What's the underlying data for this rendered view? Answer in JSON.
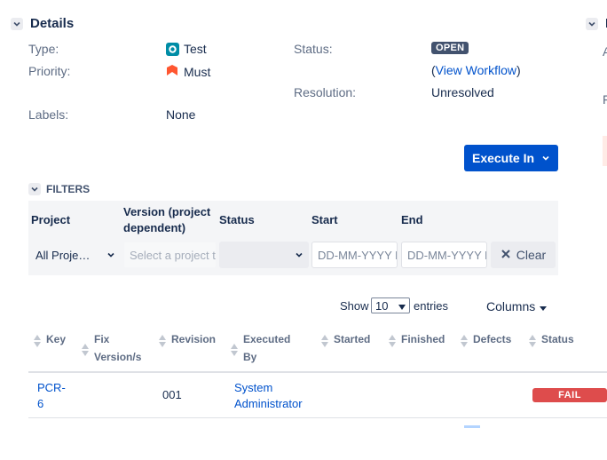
{
  "details": {
    "heading": "Details",
    "type_label": "Type:",
    "type_value": "Test",
    "priority_label": "Priority:",
    "priority_value": "Must",
    "labels_label": "Labels:",
    "labels_value": "None",
    "status_label": "Status:",
    "status_value": "OPEN",
    "view_workflow_open": "(",
    "view_workflow": "View Workflow",
    "view_workflow_close": ")",
    "resolution_label": "Resolution:",
    "resolution_value": "Unresolved"
  },
  "right_panel": {
    "heading": "P",
    "fragment1": "A",
    "fragment2": "F"
  },
  "execute": {
    "label": "Execute In"
  },
  "filters": {
    "heading": "FILTERS",
    "project_label": "Project",
    "version_label": "Version (project dependent)",
    "status_label": "Status",
    "start_label": "Start",
    "end_label": "End",
    "project_value": "All Proje…",
    "version_placeholder": "Select a project t",
    "status_value": "",
    "start_placeholder": "DD-MM-YYYY H",
    "end_placeholder": "DD-MM-YYYY H",
    "clear_label": "Clear"
  },
  "table_controls": {
    "show_label": "Show",
    "entries_value": "10",
    "entries_label": "entries",
    "columns_label": "Columns"
  },
  "table": {
    "headers": {
      "key": "Key",
      "fix_version": "Fix Version/s",
      "revision": "Revision",
      "executed_by": "Executed By",
      "started": "Started",
      "finished": "Finished",
      "defects": "Defects",
      "status": "Status"
    },
    "rows": [
      {
        "key": "PCR-6",
        "fix_version": "",
        "revision": "001",
        "executed_by": "System Administrator",
        "started": "",
        "finished": "",
        "defects": "",
        "status": "FAIL"
      }
    ]
  },
  "colors": {
    "primary": "#0052cc",
    "fail": "#de4c4c",
    "priority_must": "#ff5630",
    "test_icon": "#008da6",
    "open_badge": "#42526e"
  },
  "icons": {
    "details_toggle": "chevron-down-icon",
    "test_type": "test-type-icon",
    "priority": "priority-must-icon",
    "execute_dropdown": "chevron-down-icon",
    "clear": "close-icon",
    "sort": "sort-icon"
  }
}
